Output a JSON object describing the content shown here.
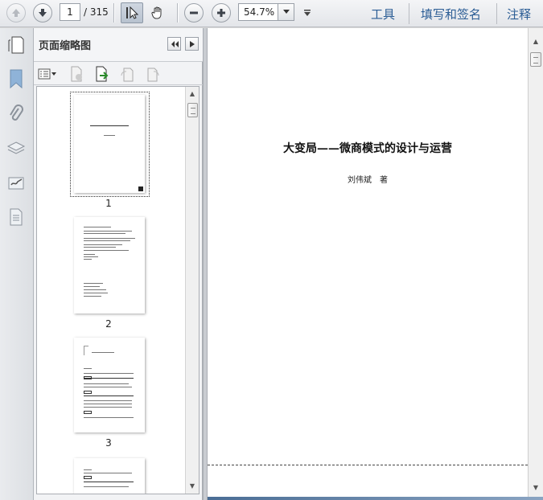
{
  "toolbar": {
    "current_page": "1",
    "page_total": "/ 315",
    "zoom": "54.7%",
    "tools_label": "工具",
    "fill_sign_label": "填写和签名",
    "comment_label": "注释"
  },
  "panel": {
    "title": "页面缩略图",
    "thumbnails": [
      {
        "page": "1"
      },
      {
        "page": "2"
      },
      {
        "page": "3"
      }
    ]
  },
  "document": {
    "title": "大变局——微商模式的设计与运营",
    "author": "刘伟斌　著"
  }
}
